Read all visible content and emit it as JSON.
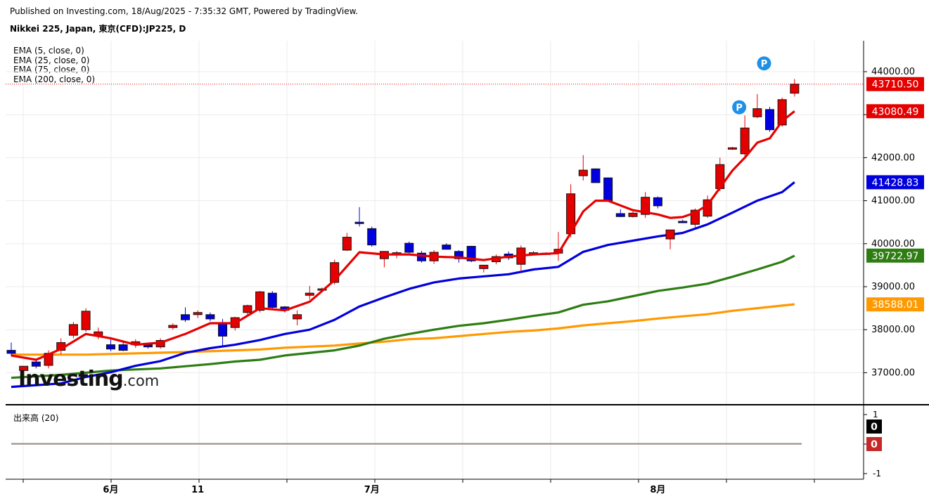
{
  "header": {
    "published": "Published on Investing.com, 18/Aug/2025 - 7:35:32 GMT, Powered by TradingView.",
    "symbol": "Nikkei 225, Japan, 東京(CFD):JP225, D"
  },
  "legend": [
    "EMA (5, close, 0)",
    "EMA (25, close, 0)",
    "EMA (75, close, 0)",
    "EMA (200, close, 0)"
  ],
  "volume_label": "出来高 (20)",
  "logo": {
    "main": "Investing",
    "suffix": ".com"
  },
  "colors": {
    "up": "#e50000",
    "down": "#0000e0",
    "ema5": "#e60000",
    "ema25": "#0000dd",
    "ema75": "#2e7d12",
    "ema200": "#ff9900",
    "grid": "#ebebeb"
  },
  "chart_data": {
    "type": "candlestick",
    "y_ticks": [
      "44000.00",
      "43000.00",
      "42000.00",
      "41000.00",
      "40000.00",
      "39000.00",
      "38000.00",
      "37000.00"
    ],
    "y_tick_values": [
      44000,
      43000,
      42000,
      41000,
      40000,
      39000,
      38000,
      37000
    ],
    "ylim": [
      36300,
      44700
    ],
    "x_labels": [
      {
        "label": "6月",
        "index": 8
      },
      {
        "label": "11",
        "index": 15
      },
      {
        "label": "7月",
        "index": 29
      },
      {
        "label": "8月",
        "index": 52
      }
    ],
    "candles": [
      [
        37520,
        37700,
        37380,
        37450
      ],
      [
        37050,
        37150,
        36950,
        37150
      ],
      [
        37250,
        37300,
        37100,
        37150
      ],
      [
        37170,
        37520,
        37100,
        37450
      ],
      [
        37520,
        37800,
        37430,
        37700
      ],
      [
        37870,
        38180,
        37800,
        38120
      ],
      [
        38000,
        38500,
        37950,
        38430
      ],
      [
        37850,
        38050,
        37780,
        37950
      ],
      [
        37650,
        37820,
        37500,
        37550
      ],
      [
        37650,
        37750,
        37500,
        37520
      ],
      [
        37650,
        37780,
        37580,
        37720
      ],
      [
        37650,
        37700,
        37560,
        37600
      ],
      [
        37600,
        37800,
        37560,
        37750
      ],
      [
        38050,
        38150,
        38000,
        38100
      ],
      [
        38350,
        38520,
        38180,
        38230
      ],
      [
        38350,
        38450,
        38270,
        38400
      ],
      [
        38350,
        38400,
        38200,
        38250
      ],
      [
        38150,
        38250,
        37600,
        37850
      ],
      [
        38050,
        38300,
        37980,
        38280
      ],
      [
        38400,
        38580,
        38350,
        38560
      ],
      [
        38450,
        38900,
        38400,
        38880
      ],
      [
        38850,
        38900,
        38480,
        38520
      ],
      [
        38530,
        38550,
        38400,
        38450
      ],
      [
        38250,
        38450,
        38100,
        38350
      ],
      [
        38800,
        39020,
        38700,
        38850
      ],
      [
        38920,
        38980,
        38880,
        38950
      ],
      [
        39100,
        39630,
        39050,
        39560
      ],
      [
        39850,
        40250,
        39830,
        40150
      ],
      [
        40500,
        40850,
        40400,
        40480
      ],
      [
        40350,
        40400,
        39930,
        39970
      ],
      [
        39650,
        39800,
        39450,
        39820
      ],
      [
        39780,
        39830,
        39660,
        39790
      ],
      [
        40010,
        40050,
        39780,
        39800
      ],
      [
        39780,
        39830,
        39560,
        39600
      ],
      [
        39600,
        39850,
        39530,
        39800
      ],
      [
        39970,
        40010,
        39880,
        39870
      ],
      [
        39820,
        39850,
        39560,
        39650
      ],
      [
        39940,
        39950,
        39570,
        39600
      ],
      [
        39420,
        39500,
        39330,
        39500
      ],
      [
        39580,
        39750,
        39520,
        39700
      ],
      [
        39760,
        39820,
        39620,
        39670
      ],
      [
        39520,
        39960,
        39350,
        39900
      ],
      [
        39780,
        39830,
        39750,
        39790
      ],
      [
        39760,
        39800,
        39740,
        39780
      ],
      [
        39780,
        40270,
        39600,
        39870
      ],
      [
        40230,
        41380,
        40150,
        41160
      ],
      [
        41580,
        42060,
        41470,
        41710
      ],
      [
        41740,
        41750,
        41430,
        41420
      ],
      [
        41530,
        41540,
        40990,
        41000
      ],
      [
        40700,
        40800,
        40620,
        40630
      ],
      [
        40630,
        40750,
        40610,
        40710
      ],
      [
        40680,
        41200,
        40600,
        41080
      ],
      [
        41070,
        41100,
        40820,
        40880
      ],
      [
        40110,
        40290,
        39870,
        40320
      ],
      [
        40520,
        40560,
        40480,
        40510
      ],
      [
        40450,
        40820,
        40380,
        40780
      ],
      [
        40640,
        41120,
        40600,
        41020
      ],
      [
        41280,
        42000,
        41220,
        41840
      ],
      [
        42210,
        42250,
        42180,
        42230
      ],
      [
        42090,
        42980,
        42040,
        42690
      ],
      [
        42950,
        43480,
        42920,
        43140
      ],
      [
        43120,
        43180,
        42600,
        42650
      ],
      [
        42760,
        43400,
        42720,
        43350
      ],
      [
        43500,
        43830,
        43420,
        43710
      ]
    ],
    "ema": [
      {
        "name": "EMA (5, close, 0)",
        "last": "43080.49",
        "points": [
          [
            0,
            37400
          ],
          [
            2,
            37300
          ],
          [
            4,
            37550
          ],
          [
            6,
            37900
          ],
          [
            8,
            37800
          ],
          [
            10,
            37650
          ],
          [
            12,
            37700
          ],
          [
            14,
            37900
          ],
          [
            16,
            38150
          ],
          [
            18,
            38150
          ],
          [
            20,
            38500
          ],
          [
            22,
            38450
          ],
          [
            24,
            38650
          ],
          [
            26,
            39150
          ],
          [
            28,
            39800
          ],
          [
            30,
            39750
          ],
          [
            32,
            39750
          ],
          [
            34,
            39700
          ],
          [
            36,
            39680
          ],
          [
            38,
            39620
          ],
          [
            40,
            39700
          ],
          [
            42,
            39750
          ],
          [
            44,
            39780
          ],
          [
            45,
            40250
          ],
          [
            46,
            40750
          ],
          [
            47,
            41000
          ],
          [
            48,
            41000
          ],
          [
            50,
            40780
          ],
          [
            52,
            40680
          ],
          [
            53,
            40600
          ],
          [
            54,
            40620
          ],
          [
            55,
            40720
          ],
          [
            56,
            40900
          ],
          [
            58,
            41700
          ],
          [
            59,
            42000
          ],
          [
            60,
            42350
          ],
          [
            61,
            42450
          ],
          [
            62,
            42850
          ],
          [
            63,
            43080
          ]
        ]
      },
      {
        "name": "EMA (25, close, 0)",
        "last": "41428.83",
        "points": [
          [
            0,
            36670
          ],
          [
            4,
            36750
          ],
          [
            6,
            36900
          ],
          [
            8,
            37010
          ],
          [
            10,
            37160
          ],
          [
            12,
            37270
          ],
          [
            14,
            37460
          ],
          [
            16,
            37570
          ],
          [
            18,
            37650
          ],
          [
            20,
            37760
          ],
          [
            22,
            37900
          ],
          [
            24,
            38000
          ],
          [
            26,
            38230
          ],
          [
            28,
            38540
          ],
          [
            30,
            38750
          ],
          [
            32,
            38950
          ],
          [
            34,
            39100
          ],
          [
            36,
            39190
          ],
          [
            38,
            39240
          ],
          [
            40,
            39290
          ],
          [
            42,
            39400
          ],
          [
            44,
            39460
          ],
          [
            46,
            39810
          ],
          [
            48,
            39970
          ],
          [
            50,
            40070
          ],
          [
            52,
            40170
          ],
          [
            54,
            40250
          ],
          [
            56,
            40450
          ],
          [
            58,
            40720
          ],
          [
            60,
            41000
          ],
          [
            62,
            41200
          ],
          [
            63,
            41430
          ]
        ]
      },
      {
        "name": "EMA (75, close, 0)",
        "last": "39722.97",
        "points": [
          [
            0,
            36880
          ],
          [
            4,
            36950
          ],
          [
            8,
            37050
          ],
          [
            12,
            37100
          ],
          [
            16,
            37200
          ],
          [
            18,
            37260
          ],
          [
            20,
            37300
          ],
          [
            22,
            37400
          ],
          [
            26,
            37520
          ],
          [
            28,
            37630
          ],
          [
            30,
            37790
          ],
          [
            32,
            37900
          ],
          [
            34,
            38000
          ],
          [
            36,
            38090
          ],
          [
            38,
            38150
          ],
          [
            40,
            38230
          ],
          [
            42,
            38320
          ],
          [
            44,
            38400
          ],
          [
            46,
            38580
          ],
          [
            48,
            38660
          ],
          [
            50,
            38780
          ],
          [
            52,
            38900
          ],
          [
            54,
            38980
          ],
          [
            56,
            39070
          ],
          [
            58,
            39230
          ],
          [
            60,
            39400
          ],
          [
            62,
            39580
          ],
          [
            63,
            39720
          ]
        ]
      },
      {
        "name": "EMA (200, close, 0)",
        "last": "38588.01",
        "points": [
          [
            0,
            37420
          ],
          [
            6,
            37420
          ],
          [
            10,
            37450
          ],
          [
            14,
            37480
          ],
          [
            18,
            37520
          ],
          [
            20,
            37540
          ],
          [
            22,
            37580
          ],
          [
            26,
            37630
          ],
          [
            28,
            37680
          ],
          [
            30,
            37720
          ],
          [
            32,
            37780
          ],
          [
            34,
            37800
          ],
          [
            36,
            37850
          ],
          [
            38,
            37900
          ],
          [
            40,
            37950
          ],
          [
            42,
            37980
          ],
          [
            44,
            38030
          ],
          [
            46,
            38100
          ],
          [
            48,
            38150
          ],
          [
            50,
            38200
          ],
          [
            52,
            38260
          ],
          [
            54,
            38310
          ],
          [
            56,
            38360
          ],
          [
            58,
            38440
          ],
          [
            60,
            38500
          ],
          [
            62,
            38560
          ],
          [
            63,
            38590
          ]
        ]
      }
    ],
    "last_price": "43710.50",
    "markers": [
      {
        "label": "P",
        "index": 59,
        "price": 42650
      },
      {
        "label": "P",
        "index": 61,
        "price": 43670
      }
    ],
    "volume": {
      "ticks": [
        "1",
        "0",
        "-1"
      ],
      "tick_values": [
        1,
        0,
        -1
      ],
      "labels": [
        "0",
        "0"
      ]
    }
  }
}
